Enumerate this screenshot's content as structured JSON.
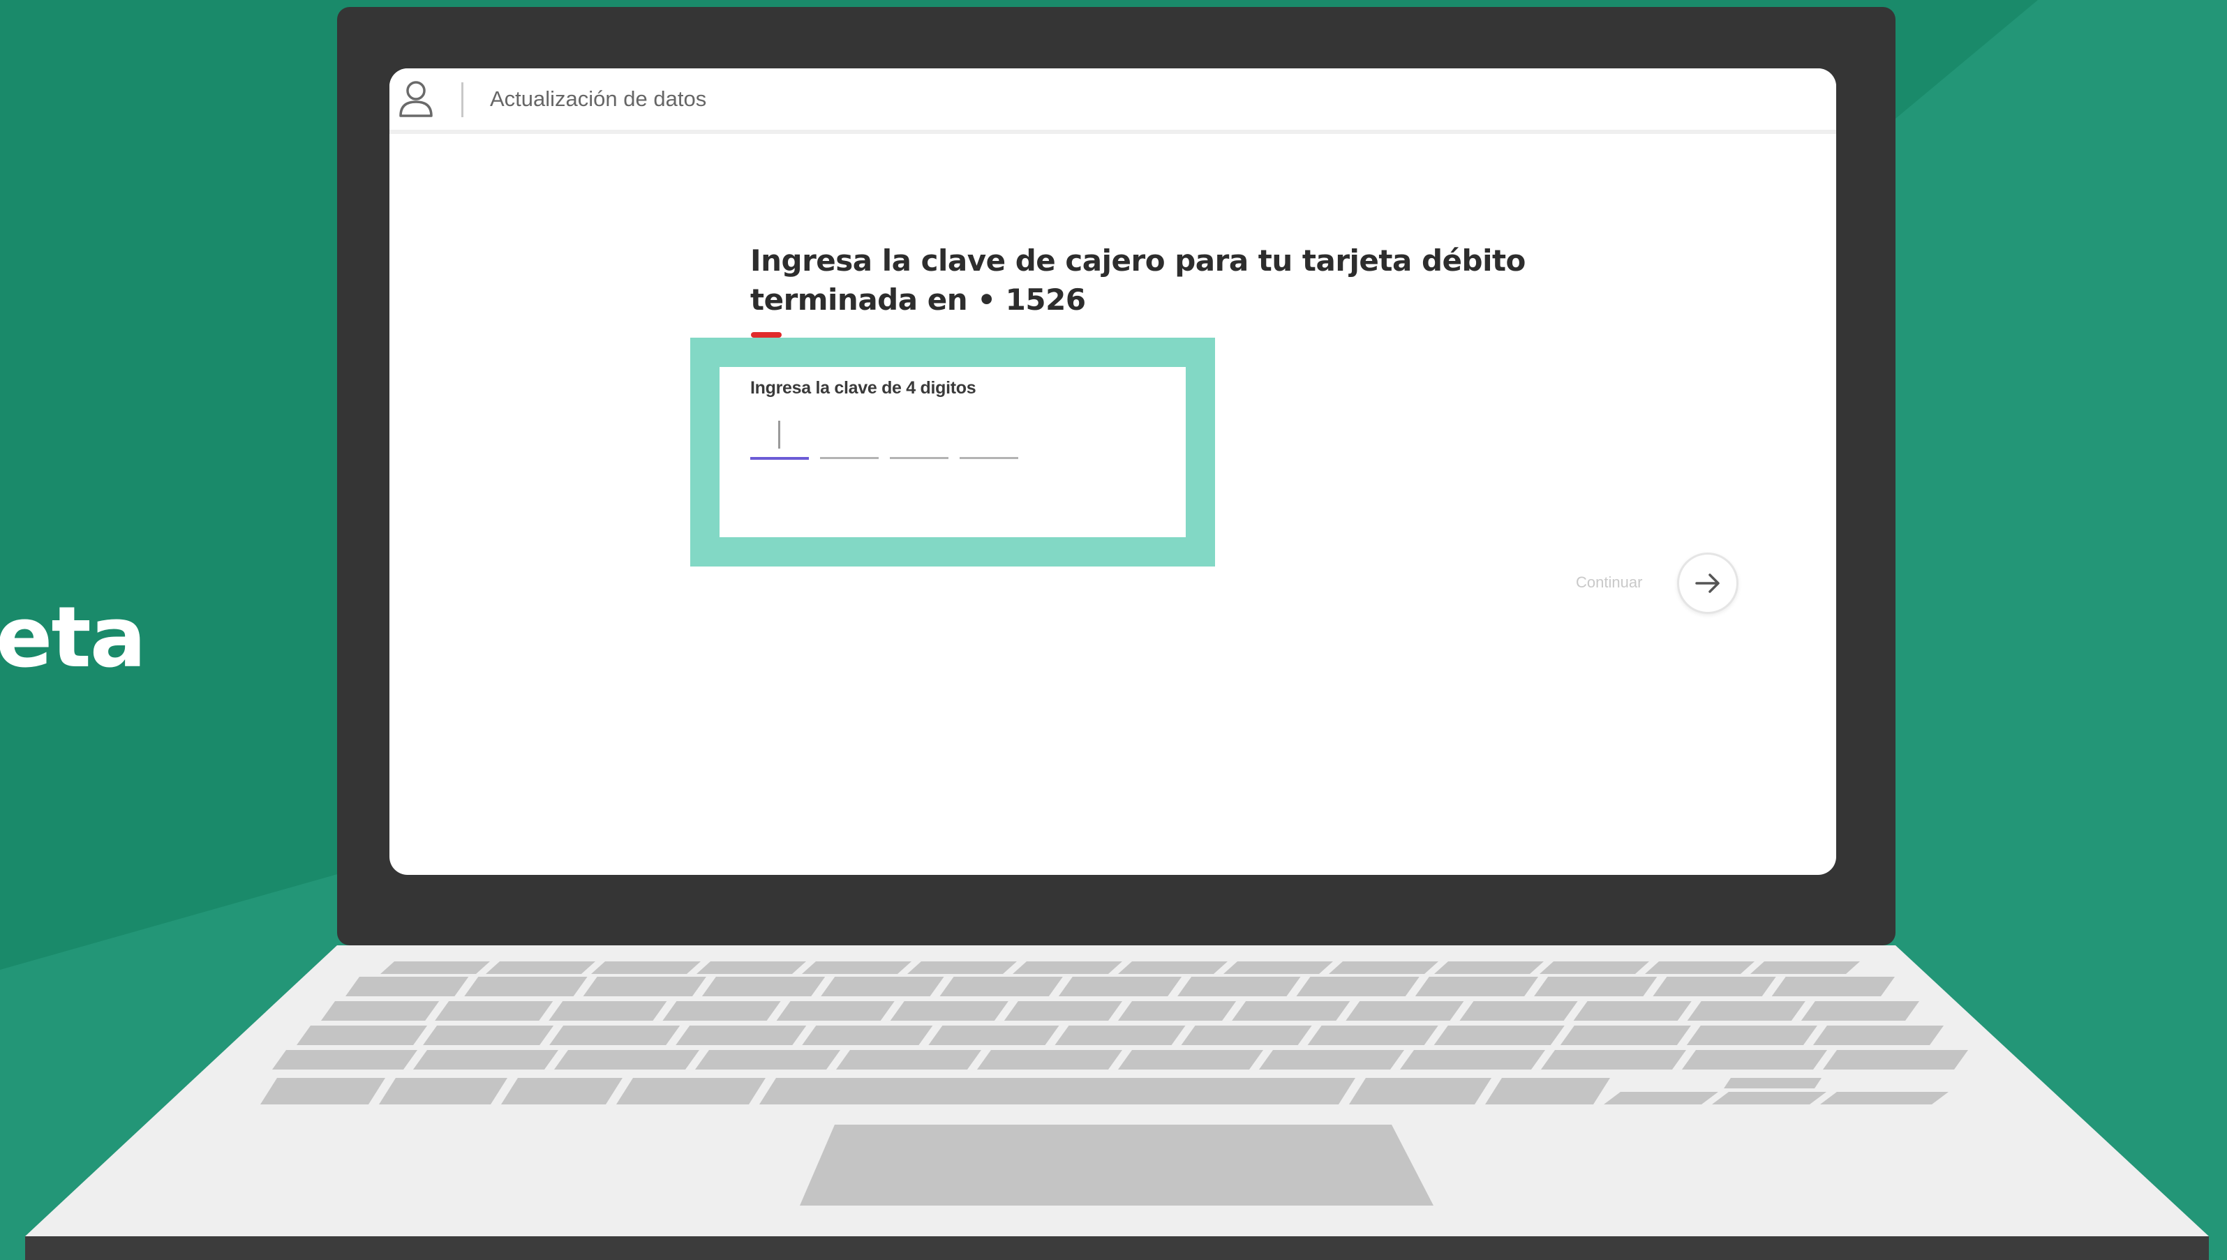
{
  "background": {
    "primary": "#1a8a6a",
    "secondary": "#239677",
    "side_text": "eta"
  },
  "screen": {
    "topbar": {
      "title": "Actualización de datos",
      "icon": "user-icon"
    },
    "heading": {
      "line1": "Ingresa la clave de cajero para tu tarjeta débito",
      "line2": "terminada en • 1526"
    },
    "pin": {
      "label": "Ingresa la clave de 4 digitos",
      "digits": 4,
      "active_index": 0
    },
    "continue": {
      "label": "Continuar",
      "icon": "arrow-right-icon"
    }
  },
  "colors": {
    "accent_red": "#e02b2b",
    "highlight": "#82d8c5",
    "input_active": "#6b5bd6",
    "bezel": "#353535",
    "keyboard_deck": "#efefef",
    "keys": "#c4c4c4"
  }
}
